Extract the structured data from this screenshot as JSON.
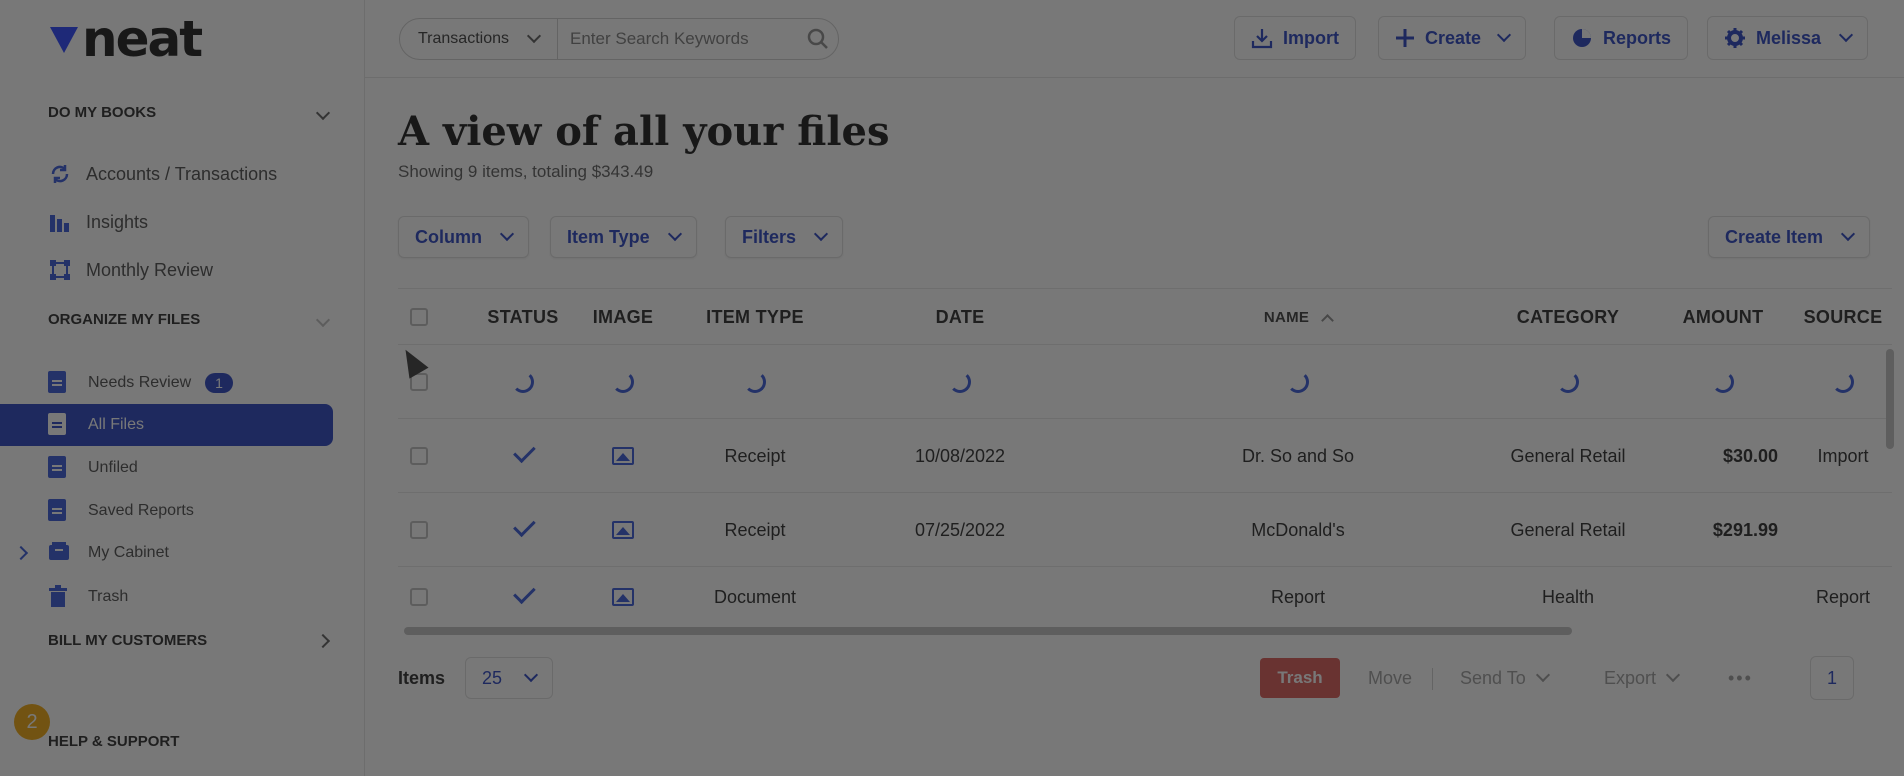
{
  "brand": {
    "logo_text": "neat",
    "accent": "#1f3bbf",
    "warning": "#f0a400"
  },
  "sidebar": {
    "section_books": "DO MY BOOKS",
    "books_items": [
      {
        "label": "Accounts / Transactions",
        "icon": "sync-icon"
      },
      {
        "label": "Insights",
        "icon": "bar-chart-icon"
      },
      {
        "label": "Monthly Review",
        "icon": "network-icon"
      }
    ],
    "section_files": "ORGANIZE MY FILES",
    "file_items": [
      {
        "label": "Needs Review",
        "badge": "1"
      },
      {
        "label": "All Files"
      },
      {
        "label": "Unfiled"
      },
      {
        "label": "Saved Reports"
      },
      {
        "label": "My Cabinet"
      },
      {
        "label": "Trash"
      }
    ],
    "section_bill": "BILL MY CUSTOMERS",
    "section_help": "HELP & SUPPORT",
    "help_badge": "2"
  },
  "topbar": {
    "search_type": "Transactions",
    "search_placeholder": "Enter Search Keywords",
    "import_label": "Import",
    "create_label": "Create",
    "reports_label": "Reports",
    "user_label": "Melissa"
  },
  "main": {
    "title": "A view of all your files",
    "subtitle": "Showing 9 items, totaling $343.49",
    "filters": {
      "column": "Column",
      "item_type": "Item Type",
      "filters": "Filters",
      "create_item": "Create Item"
    }
  },
  "table": {
    "headers": {
      "status": "STATUS",
      "image": "IMAGE",
      "item_type": "ITEM TYPE",
      "date": "DATE",
      "name": "NAME",
      "category": "CATEGORY",
      "amount": "AMOUNT",
      "source": "SOURCE"
    },
    "rows": [
      {
        "item_type": "Receipt",
        "date": "10/08/2022",
        "name": "Dr. So and So",
        "category": "General Retail",
        "amount": "$30.00",
        "source": "Import"
      },
      {
        "item_type": "Receipt",
        "date": "07/25/2022",
        "name": "McDonald's",
        "category": "General Retail",
        "amount": "$291.99",
        "source": ""
      },
      {
        "item_type": "Document",
        "date": "",
        "name": "Report",
        "category": "Health",
        "amount": "",
        "source": "Report"
      }
    ]
  },
  "footer": {
    "items_label": "Items",
    "page_size": "25",
    "trash": "Trash",
    "move": "Move",
    "send_to": "Send To",
    "export": "Export",
    "more": "•••",
    "page": "1"
  }
}
